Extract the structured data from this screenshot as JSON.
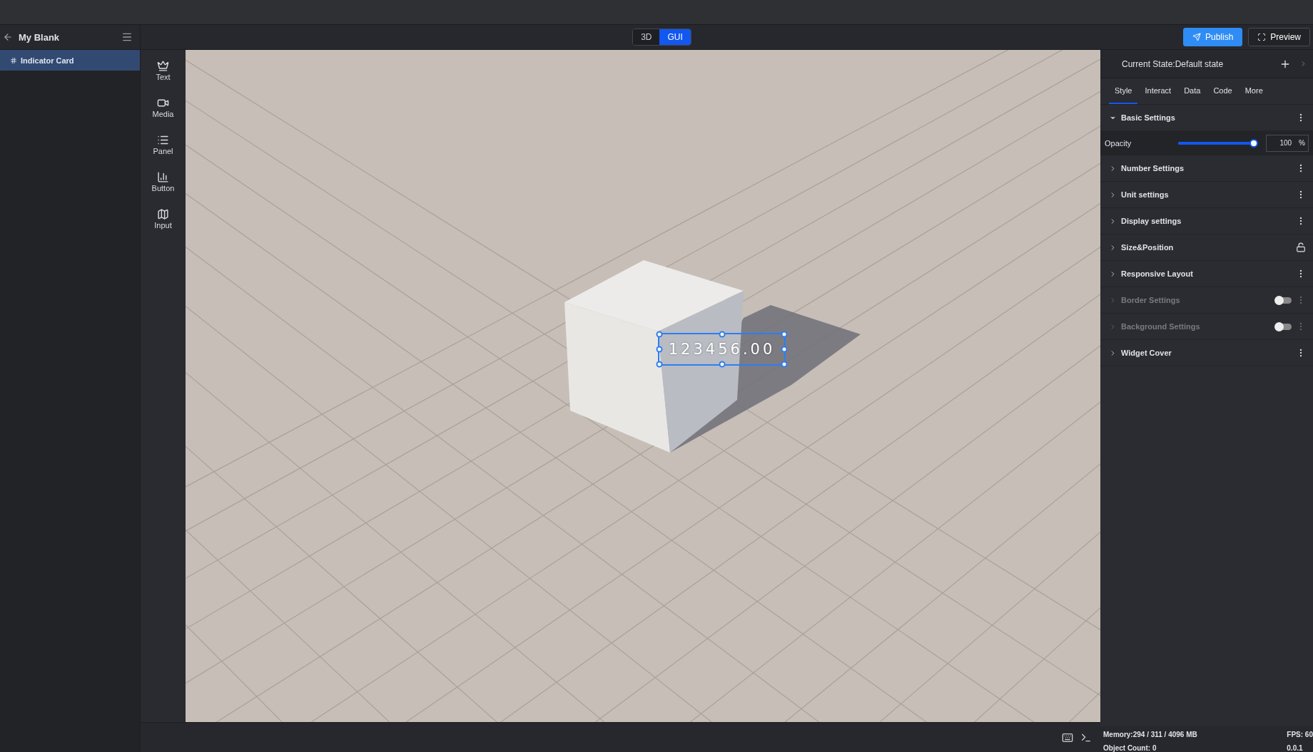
{
  "project": {
    "title": "My Blank"
  },
  "layers": [
    {
      "label": "Indicator Card",
      "selected": true
    }
  ],
  "mode_toggle": [
    {
      "label": "3D",
      "selected": false
    },
    {
      "label": "GUI",
      "selected": true
    }
  ],
  "actions": [
    {
      "label": "Publish",
      "kind": "primary"
    },
    {
      "label": "Preview",
      "kind": "secondary"
    }
  ],
  "components": [
    {
      "label": "Text",
      "kind": "text"
    },
    {
      "label": "Media",
      "kind": "media"
    },
    {
      "label": "Panel",
      "kind": "panel"
    },
    {
      "label": "Button",
      "kind": "chart"
    },
    {
      "label": "Input",
      "kind": "map"
    }
  ],
  "viewport": {
    "widget_value": "123456.00"
  },
  "inspector": {
    "state": "Current State:Default state",
    "tabs": [
      {
        "label": "Style",
        "selected": true
      },
      {
        "label": "Interact",
        "selected": false
      },
      {
        "label": "Data",
        "selected": false
      },
      {
        "label": "Code",
        "selected": false
      },
      {
        "label": "More",
        "selected": false
      }
    ],
    "opacity": {
      "label": "Opacity",
      "level": 1,
      "value": "100",
      "unit": "%"
    },
    "sections": [
      {
        "title": "Basic Settings",
        "expanded": true,
        "kind": "menu",
        "disabled": false
      },
      {
        "title": "Number Settings",
        "expanded": false,
        "kind": "menu",
        "disabled": false
      },
      {
        "title": "Unit settings",
        "expanded": false,
        "kind": "menu",
        "disabled": false
      },
      {
        "title": "Display settings",
        "expanded": false,
        "kind": "menu",
        "disabled": false
      },
      {
        "title": "Size&Position",
        "expanded": false,
        "kind": "lock",
        "disabled": false
      },
      {
        "title": "Responsive Layout",
        "expanded": false,
        "kind": "menu",
        "disabled": false
      },
      {
        "title": "Border Settings",
        "expanded": false,
        "kind": "toggle",
        "on": false,
        "disabled": true
      },
      {
        "title": "Background Settings",
        "expanded": false,
        "kind": "toggle",
        "on": false,
        "disabled": true
      },
      {
        "title": "Widget Cover",
        "expanded": false,
        "kind": "menu",
        "disabled": false
      }
    ]
  },
  "status_bar": {
    "memory": "Memory:294 / 311 / 4096 MB",
    "fps": "FPS: 60",
    "object_count": "Object Count: 0",
    "version": "0.0.1"
  }
}
